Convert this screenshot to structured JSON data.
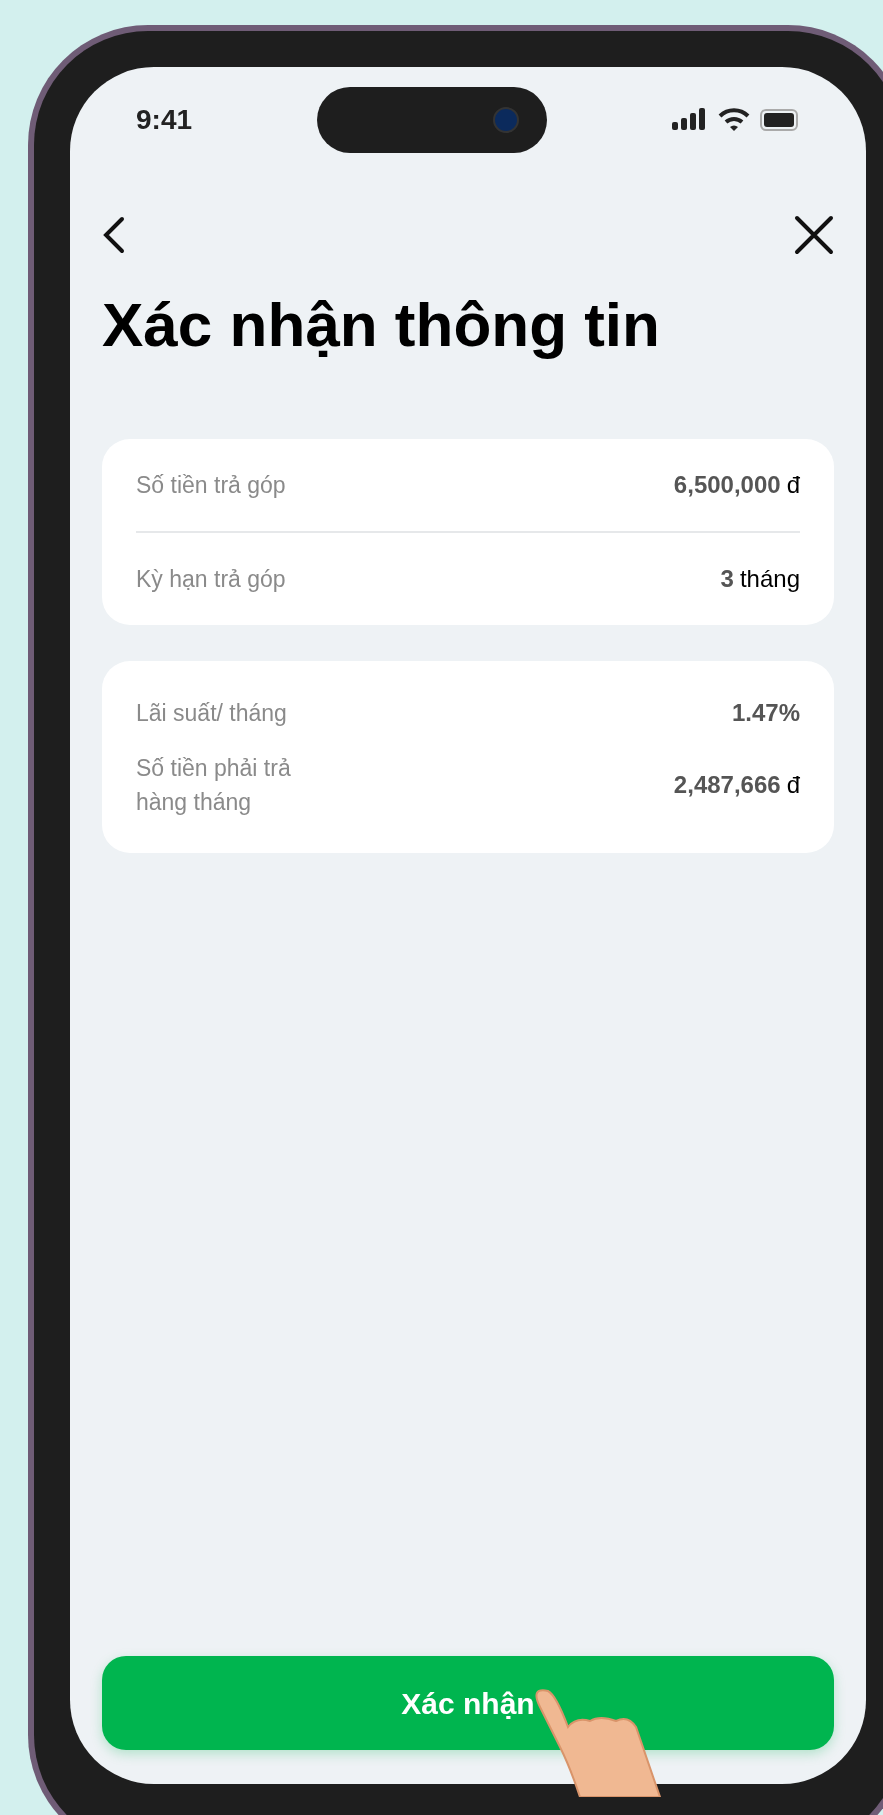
{
  "status_bar": {
    "time": "9:41"
  },
  "title": "Xác nhận thông tin",
  "cards": [
    {
      "rows": [
        {
          "label": "Số tiền trả góp",
          "value": "6,500,000",
          "unit": "đ"
        },
        {
          "label": "Kỳ hạn trả góp",
          "value": "3",
          "unit": "tháng"
        }
      ]
    },
    {
      "rows": [
        {
          "label": "Lãi suất/ tháng",
          "value": "1.47%"
        },
        {
          "label": "Số tiền phải trả hàng tháng",
          "value": "2,487,666",
          "unit": "đ"
        }
      ]
    }
  ],
  "confirm_button": "Xác nhận"
}
